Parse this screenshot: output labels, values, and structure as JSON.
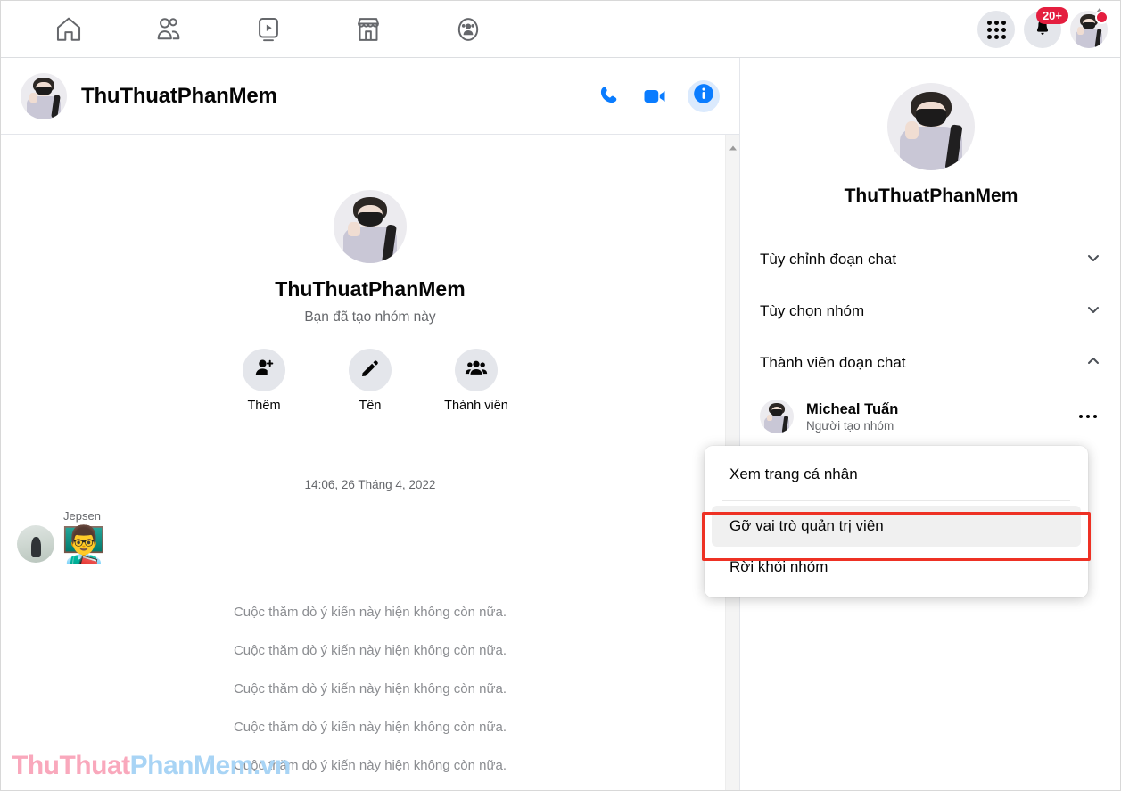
{
  "topnav": {
    "items": [
      {
        "name": "home-icon",
        "label": "Trang chủ"
      },
      {
        "name": "friends-icon",
        "label": "Bạn bè"
      },
      {
        "name": "watch-icon",
        "label": "Watch"
      },
      {
        "name": "marketplace-icon",
        "label": "Marketplace"
      },
      {
        "name": "groups-icon",
        "label": "Nhóm"
      }
    ],
    "menu_label": "Menu",
    "notifications_badge": "20+",
    "account_label": "Tài khoản"
  },
  "chat_header": {
    "title": "ThuThuatPhanMem",
    "call_label": "Gọi thoại",
    "video_label": "Gọi video",
    "info_label": "Thông tin về đoạn chat"
  },
  "thread": {
    "profile_name": "ThuThuatPhanMem",
    "profile_subtitle": "Bạn đã tạo nhóm này",
    "actions": [
      {
        "icon": "add-person-icon",
        "label": "Thêm"
      },
      {
        "icon": "pencil-icon",
        "label": "Tên"
      },
      {
        "icon": "members-icon",
        "label": "Thành viên"
      }
    ],
    "timestamp": "14:06, 26 Tháng 4, 2022",
    "message_sender": "Jepsen",
    "sticker": "👨‍🏫",
    "poll_messages": [
      "Cuộc thăm dò ý kiến này hiện không còn nữa.",
      "Cuộc thăm dò ý kiến này hiện không còn nữa.",
      "Cuộc thăm dò ý kiến này hiện không còn nữa.",
      "Cuộc thăm dò ý kiến này hiện không còn nữa.",
      "Cuộc thăm dò ý kiến này hiện không còn nữa."
    ],
    "watermark_part1": "ThuThuat",
    "watermark_part2": "PhanMem.vn"
  },
  "sidebar": {
    "profile_name": "ThuThuatPhanMem",
    "sections": [
      {
        "label": "Tùy chỉnh đoạn chat",
        "state": "collapsed"
      },
      {
        "label": "Tùy chọn nhóm",
        "state": "collapsed"
      },
      {
        "label": "Thành viên đoạn chat",
        "state": "expanded"
      }
    ],
    "members": [
      {
        "name": "Micheal Tuấn",
        "role": "Người tạo nhóm"
      }
    ]
  },
  "context_menu": {
    "items": [
      {
        "label": "Xem trang cá nhân",
        "selected": false
      },
      {
        "label": "Gỡ vai trò quản trị viên",
        "selected": true
      },
      {
        "label": "Rời khỏi nhóm",
        "selected": false
      }
    ],
    "highlight_color": "#ee3124"
  }
}
